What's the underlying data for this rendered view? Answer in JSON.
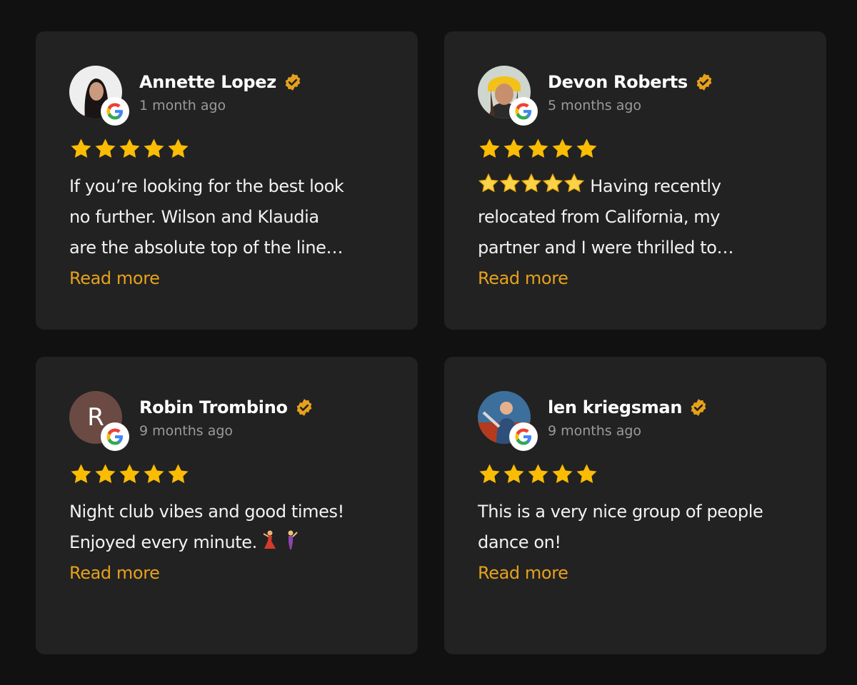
{
  "reviews": [
    {
      "name": "Annette Lopez",
      "time": "1 month ago",
      "rating": 5,
      "text_lines": [
        "If you’re looking for the best look",
        "no further. Wilson and Klaudia",
        "are the absolute top of the line…"
      ],
      "read_more": "Read more",
      "avatar": "photo"
    },
    {
      "name": "Devon Roberts",
      "time": "5 months ago",
      "rating": 5,
      "text_lines": [
        "Having recently",
        "relocated from California, my",
        "partner and I were thrilled to…"
      ],
      "read_more": "Read more",
      "avatar": "photo"
    },
    {
      "name": "Robin Trombino",
      "time": "9 months ago",
      "rating": 5,
      "text_lines": [
        "Night club vibes and good times!",
        "Enjoyed every minute."
      ],
      "read_more": "Read more",
      "avatar": "initial",
      "avatar_initial": "R"
    },
    {
      "name": "len kriegsman",
      "time": "9 months ago",
      "rating": 5,
      "text_lines": [
        "This is a very nice group of people",
        "dance on!"
      ],
      "read_more": "Read more",
      "avatar": "photo"
    }
  ],
  "colors": {
    "background": "#111111",
    "card": "#222222",
    "star": "#fbbc04",
    "accent": "#e6a11c",
    "muted": "#9a9a9a"
  },
  "icons": [
    "google-icon",
    "verified-badge-icon",
    "star-icon",
    "dancer-emoji-icon"
  ]
}
